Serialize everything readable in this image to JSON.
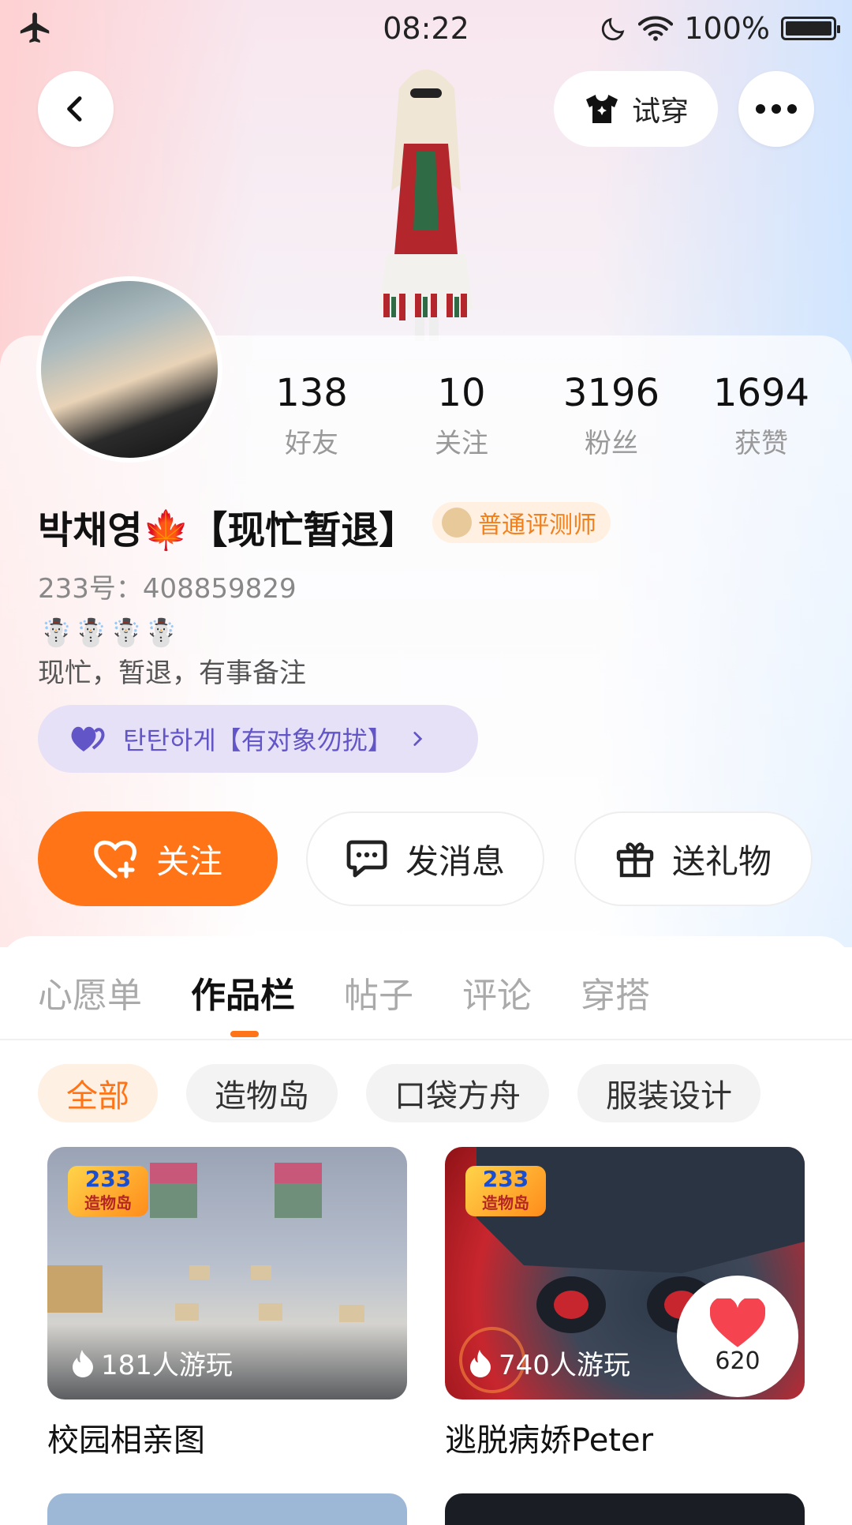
{
  "status": {
    "time": "08:22",
    "battery": "100%"
  },
  "top": {
    "try_on_label": "试穿"
  },
  "stats": [
    {
      "value": "138",
      "label": "好友"
    },
    {
      "value": "10",
      "label": "关注"
    },
    {
      "value": "3196",
      "label": "粉丝"
    },
    {
      "value": "1694",
      "label": "获赞"
    }
  ],
  "profile": {
    "username": "박채영🍁【现忙暂退】",
    "badge": "普通评测师",
    "uid": "233号：408859829",
    "snowmen": "☃️☃️☃️☃️",
    "bio": "现忙，暂退，有事备注",
    "relation_tag": "탄탄하게【有对象勿扰】"
  },
  "actions": {
    "follow": "关注",
    "message": "发消息",
    "gift": "送礼物"
  },
  "tabs": [
    "心愿单",
    "作品栏",
    "帖子",
    "评论",
    "穿搭"
  ],
  "active_tab": "作品栏",
  "filters": [
    "全部",
    "造物岛",
    "口袋方舟",
    "服装设计"
  ],
  "works": [
    {
      "title": "校园相亲图",
      "plays": "181人游玩",
      "logo_top": "233",
      "logo_bottom": "造物岛"
    },
    {
      "title": "逃脱病娇Peter",
      "plays": "740人游玩",
      "logo_top": "233",
      "logo_bottom": "造物岛",
      "likes": "620"
    }
  ],
  "colors": {
    "accent": "#ff7416",
    "tag_purple": "#6255c7"
  }
}
